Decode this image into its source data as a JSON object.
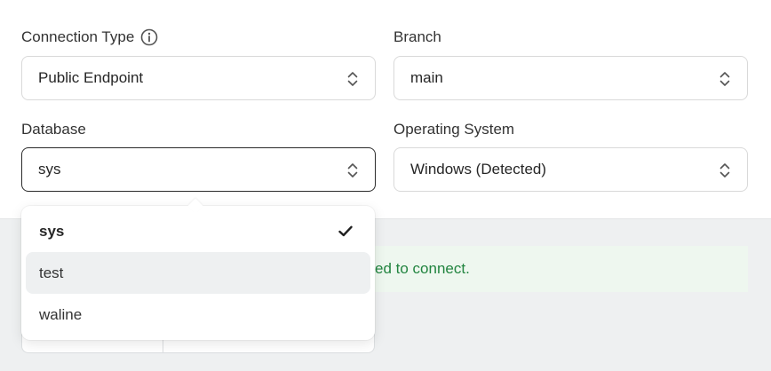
{
  "connection_type": {
    "label": "Connection Type",
    "value": "Public Endpoint",
    "info_icon": "info-icon"
  },
  "branch": {
    "label": "Branch",
    "value": "main"
  },
  "database": {
    "label": "Database",
    "value": "sys",
    "options": [
      {
        "label": "sys",
        "selected": true
      },
      {
        "label": "test",
        "selected": false
      },
      {
        "label": "waline",
        "selected": false
      }
    ]
  },
  "operating_system": {
    "label": "Operating System",
    "value": "Windows (Detected)"
  },
  "banner": {
    "text_visible": "ed to connect."
  },
  "colors": {
    "banner_text": "#21843f",
    "banner_bg": "#eef7ef",
    "panel_bg": "#eef0f1"
  }
}
